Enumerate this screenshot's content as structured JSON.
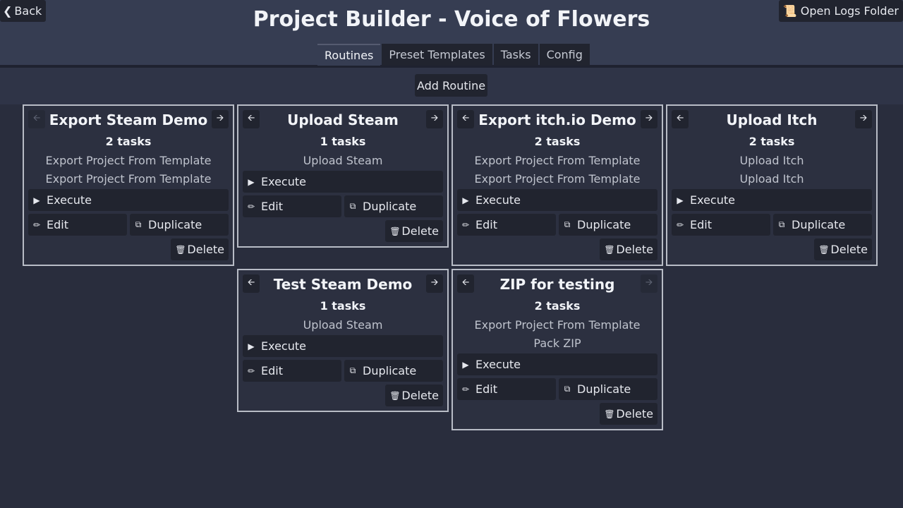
{
  "header": {
    "back_label": "Back",
    "title": "Project Builder - Voice of Flowers",
    "logs_label": "Open Logs Folder",
    "tabs": [
      {
        "label": "Routines",
        "active": true
      },
      {
        "label": "Preset Templates",
        "active": false
      },
      {
        "label": "Tasks",
        "active": false
      },
      {
        "label": "Config",
        "active": false
      }
    ]
  },
  "toolbar": {
    "add_label": "Add Routine"
  },
  "buttons": {
    "execute": "Execute",
    "edit": "Edit",
    "duplicate": "Duplicate",
    "delete": "Delete"
  },
  "routines": [
    {
      "name": "Export Steam Demo",
      "count": "2 tasks",
      "tasks": [
        "Export Project From Template",
        "Export Project From Template"
      ],
      "left_enabled": false,
      "right_enabled": true
    },
    {
      "name": "Upload Steam",
      "count": "1 tasks",
      "tasks": [
        "Upload Steam"
      ],
      "left_enabled": true,
      "right_enabled": true
    },
    {
      "name": "Export itch.io Demo",
      "count": "2 tasks",
      "tasks": [
        "Export Project From Template",
        "Export Project From Template"
      ],
      "left_enabled": true,
      "right_enabled": true
    },
    {
      "name": "Upload Itch",
      "count": "2 tasks",
      "tasks": [
        "Upload Itch",
        "Upload Itch"
      ],
      "left_enabled": true,
      "right_enabled": true
    },
    {
      "name": "Test Steam Demo",
      "count": "1 tasks",
      "tasks": [
        "Upload Steam"
      ],
      "left_enabled": true,
      "right_enabled": true
    },
    {
      "name": "ZIP for testing",
      "count": "2 tasks",
      "tasks": [
        "Export Project From Template",
        "Pack ZIP"
      ],
      "left_enabled": true,
      "right_enabled": false
    }
  ],
  "icons": {
    "back": "chevron-left-icon",
    "logs": "scroll-icon",
    "left": "arrow-left-icon",
    "right": "arrow-right-icon",
    "execute": "play-icon",
    "edit": "pencil-icon",
    "duplicate": "duplicate-icon",
    "delete": "trash-icon"
  }
}
